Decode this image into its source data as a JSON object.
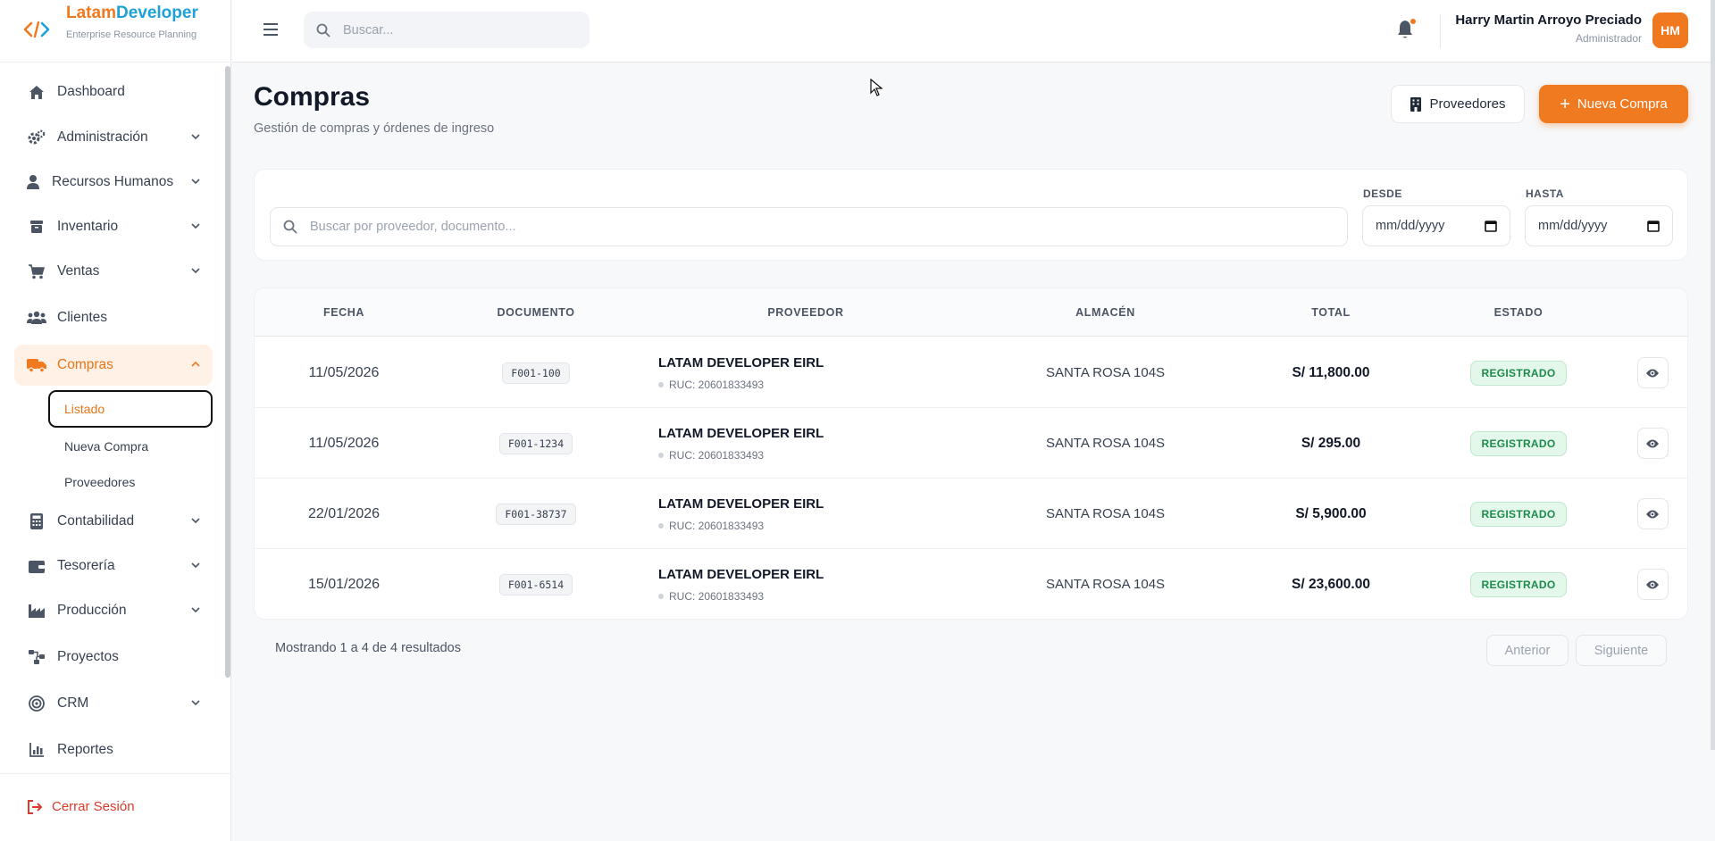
{
  "brand": {
    "name_part1": "Latam",
    "name_part2": "Developer",
    "subtitle": "Enterprise Resource Planning"
  },
  "sidebar": {
    "items": [
      {
        "label": "Dashboard",
        "icon": "home-icon",
        "has_chevron": false
      },
      {
        "label": "Administración",
        "icon": "gears-icon",
        "has_chevron": true
      },
      {
        "label": "Recursos Humanos",
        "icon": "user-icon",
        "has_chevron": true
      },
      {
        "label": "Inventario",
        "icon": "box-icon",
        "has_chevron": true
      },
      {
        "label": "Ventas",
        "icon": "cart-icon",
        "has_chevron": true
      },
      {
        "label": "Clientes",
        "icon": "users-icon",
        "has_chevron": false
      },
      {
        "label": "Compras",
        "icon": "truck-icon",
        "has_chevron": true,
        "active": true
      },
      {
        "label": "Contabilidad",
        "icon": "calculator-icon",
        "has_chevron": true
      },
      {
        "label": "Tesorería",
        "icon": "wallet-icon",
        "has_chevron": true
      },
      {
        "label": "Producción",
        "icon": "factory-icon",
        "has_chevron": true
      },
      {
        "label": "Proyectos",
        "icon": "diagram-icon",
        "has_chevron": false
      },
      {
        "label": "CRM",
        "icon": "target-icon",
        "has_chevron": true
      },
      {
        "label": "Reportes",
        "icon": "bar-chart-icon",
        "has_chevron": false
      }
    ],
    "compras_sub": [
      {
        "label": "Listado",
        "current": true
      },
      {
        "label": "Nueva Compra"
      },
      {
        "label": "Proveedores"
      }
    ],
    "logout_label": "Cerrar Sesión"
  },
  "topbar": {
    "search_placeholder": "Buscar...",
    "user_name": "Harry Martin Arroyo Preciado",
    "user_role": "Administrador",
    "avatar_initials": "HM"
  },
  "page": {
    "title": "Compras",
    "subtitle": "Gestión de compras y órdenes de ingreso",
    "btn_proveedores": "Proveedores",
    "btn_nueva": "Nueva Compra"
  },
  "filters": {
    "search_placeholder": "Buscar por proveedor, documento...",
    "desde_label": "DESDE",
    "hasta_label": "HASTA",
    "desde_value": "mm/dd/yyyy",
    "hasta_value": "mm/dd/yyyy"
  },
  "table": {
    "headers": [
      "FECHA",
      "DOCUMENTO",
      "PROVEEDOR",
      "ALMACÉN",
      "TOTAL",
      "ESTADO"
    ],
    "rows": [
      {
        "fecha": "11/05/2026",
        "documento": "F001-100",
        "proveedor": "LATAM DEVELOPER EIRL",
        "ruc": "RUC: 20601833493",
        "almacen": "SANTA ROSA 104S",
        "total": "S/ 11,800.00",
        "estado": "REGISTRADO"
      },
      {
        "fecha": "11/05/2026",
        "documento": "F001-1234",
        "proveedor": "LATAM DEVELOPER EIRL",
        "ruc": "RUC: 20601833493",
        "almacen": "SANTA ROSA 104S",
        "total": "S/ 295.00",
        "estado": "REGISTRADO"
      },
      {
        "fecha": "22/01/2026",
        "documento": "F001-38737",
        "proveedor": "LATAM DEVELOPER EIRL",
        "ruc": "RUC: 20601833493",
        "almacen": "SANTA ROSA 104S",
        "total": "S/ 5,900.00",
        "estado": "REGISTRADO"
      },
      {
        "fecha": "15/01/2026",
        "documento": "F001-6514",
        "proveedor": "LATAM DEVELOPER EIRL",
        "ruc": "RUC: 20601833493",
        "almacen": "SANTA ROSA 104S",
        "total": "S/ 23,600.00",
        "estado": "REGISTRADO"
      }
    ]
  },
  "pagination": {
    "summary": "Mostrando 1 a 4 de 4 resultados",
    "prev": "Anterior",
    "next": "Siguiente"
  },
  "colors": {
    "accent": "#ef7a1f",
    "brand_blue": "#1da1d8",
    "success": "#1e8a4c",
    "danger": "#dc3b2b"
  }
}
